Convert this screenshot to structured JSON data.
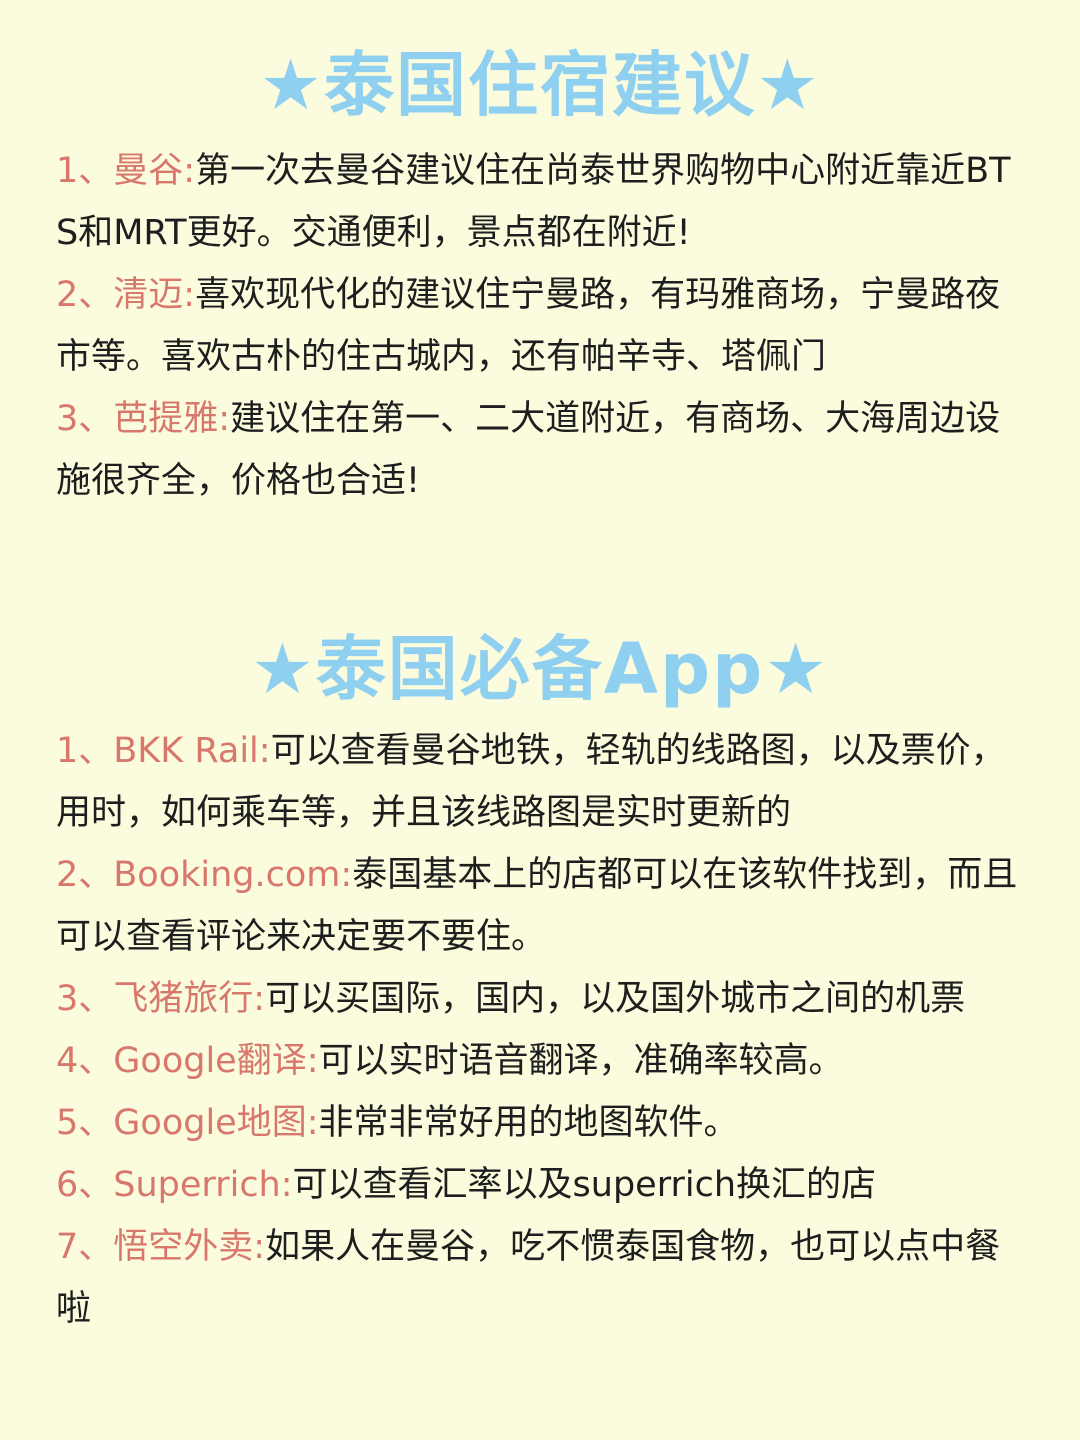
{
  "sections": [
    {
      "title": "★泰国住宿建议★",
      "items": [
        {
          "num": "1、",
          "name": "曼谷:",
          "desc": "第一次去曼谷建议住在尚泰世界购物中心附近靠近BTS和MRT更好。交通便利，景点都在附近!"
        },
        {
          "num": "2、",
          "name": "清迈:",
          "desc": "喜欢现代化的建议住宁曼路，有玛雅商场，宁曼路夜市等。喜欢古朴的住古城内，还有帕辛寺、塔佩门"
        },
        {
          "num": "3、",
          "name": "芭提雅:",
          "desc": "建议住在第一、二大道附近，有商场、大海周边设施很齐全，价格也合适!"
        }
      ]
    },
    {
      "title": "★泰国必备App★",
      "items": [
        {
          "num": "1、",
          "name": "BKK Rail:",
          "desc": "可以查看曼谷地铁，轻轨的线路图，以及票价，用时，如何乘车等，并且该线路图是实时更新的"
        },
        {
          "num": "2、",
          "name": "Booking.com:",
          "desc": "泰国基本上的店都可以在该软件找到，而且可以查看评论来决定要不要住。"
        },
        {
          "num": "3、",
          "name": "飞猪旅行:",
          "desc": "可以买国际，国内，以及国外城市之间的机票"
        },
        {
          "num": "4、",
          "name": "Google翻译:",
          "desc": "可以实时语音翻译，准确率较高。"
        },
        {
          "num": "5、",
          "name": "Google地图:",
          "desc": "非常非常好用的地图软件。"
        },
        {
          "num": "6、",
          "name": "Superrich:",
          "desc": "可以查看汇率以及superrich换汇的店"
        },
        {
          "num": "7、",
          "name": "悟空外卖:",
          "desc": "如果人在曼谷，吃不惯泰国食物，也可以点中餐啦"
        }
      ]
    }
  ],
  "colors": {
    "background": "#fbfbde",
    "title": "#8fd0f1",
    "accent": "#d8786c",
    "text": "#1e1e1e"
  }
}
